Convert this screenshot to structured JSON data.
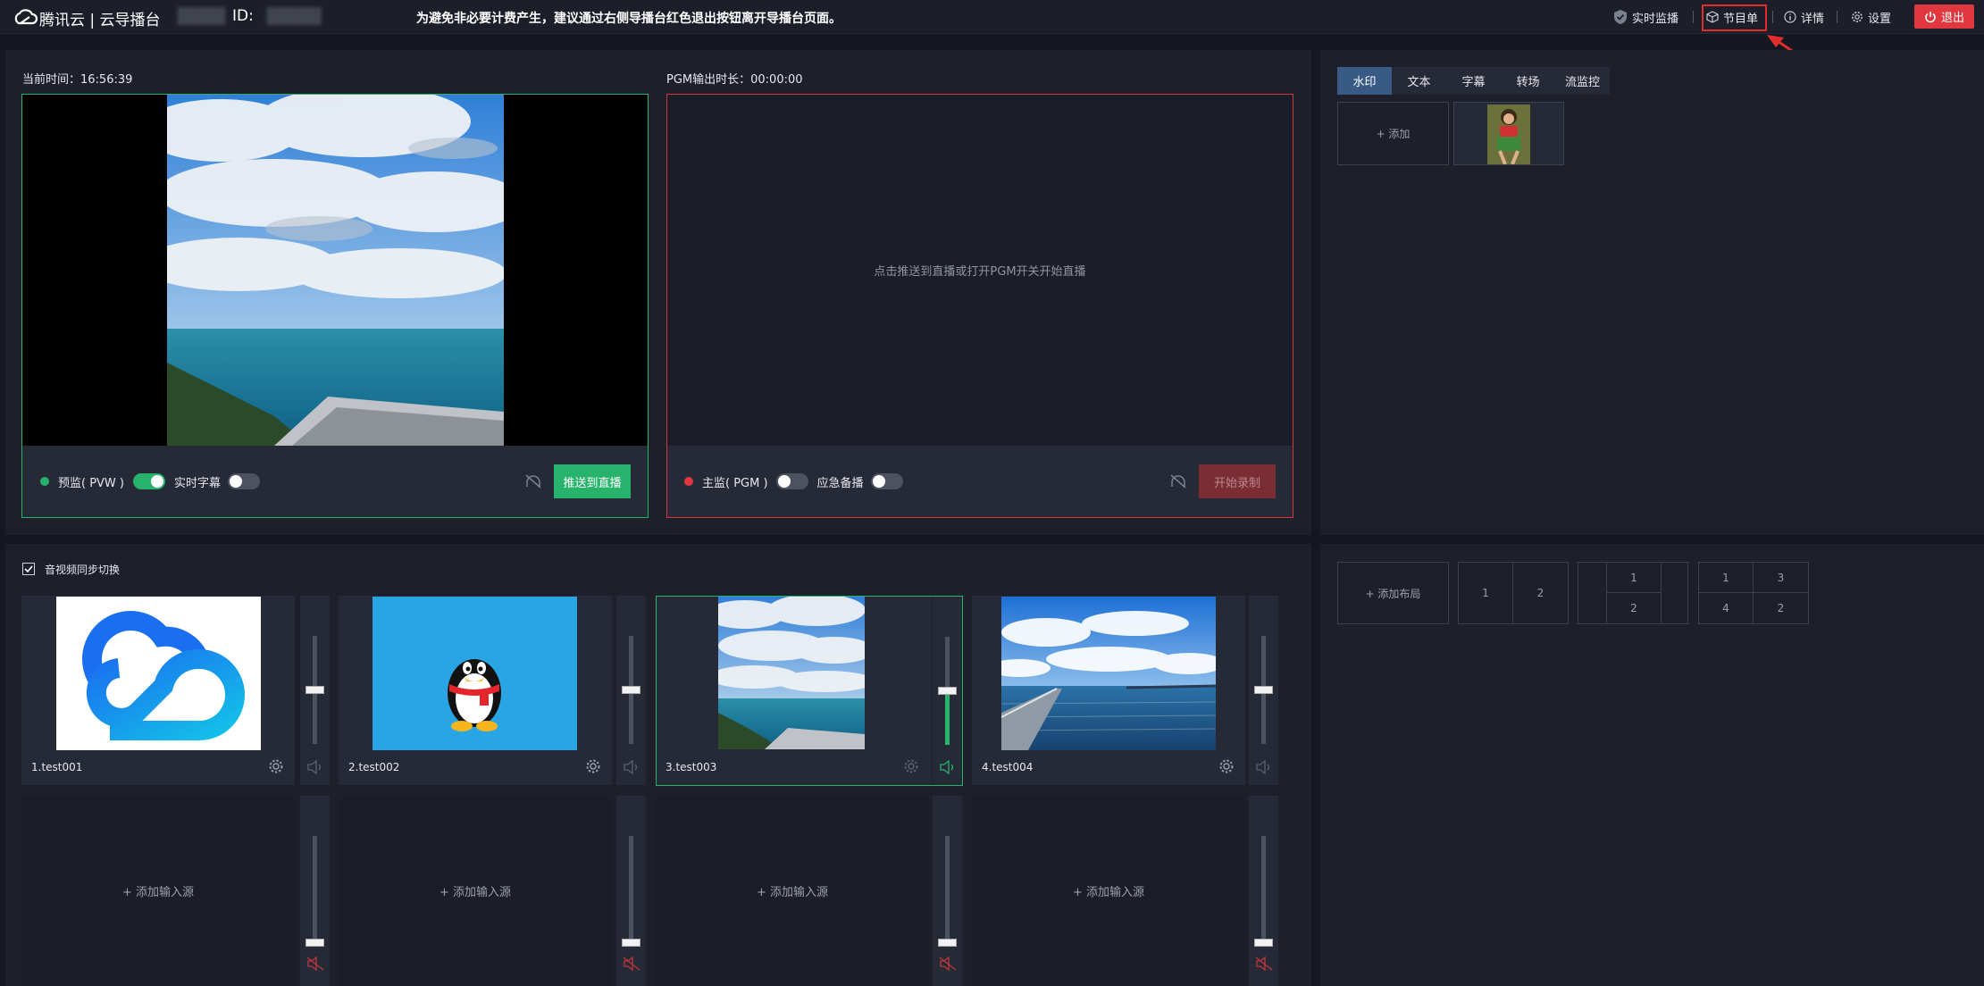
{
  "header": {
    "brand": "腾讯云 | 云导播台",
    "id_label": "ID:",
    "notice": "为避免非必要计费产生，建议通过右侧导播台红色退出按钮离开导播台页面。",
    "realtime_monitor": "实时监播",
    "program_list": "节目单",
    "details": "详情",
    "settings": "设置",
    "exit": "退出"
  },
  "preview": {
    "time_label": "当前时间：16:56:39",
    "pvw_label": "预监( PVW )",
    "pvw_toggle_on": true,
    "subtitle_label": "实时字幕",
    "subtitle_toggle_on": false,
    "push_button": "推送到直播"
  },
  "program": {
    "duration_label": "PGM输出时长：00:00:00",
    "placeholder": "点击推送到直播或打开PGM开关开始直播",
    "pgm_label": "主监( PGM )",
    "pgm_toggle_on": false,
    "backup_label": "应急备播",
    "backup_toggle_on": false,
    "record_button": "开始录制"
  },
  "right_tabs": [
    "水印",
    "文本",
    "字幕",
    "转场",
    "流监控"
  ],
  "watermark": {
    "add_label": "+ 添加"
  },
  "sources": {
    "sync_label": "音视频同步切换",
    "items": [
      {
        "name": "1.test001",
        "level": 0.5
      },
      {
        "name": "2.test002",
        "level": 0.5
      },
      {
        "name": "3.test003",
        "level": 0.5
      },
      {
        "name": "4.test004",
        "level": 0.5
      }
    ],
    "add_label": "+ 添加输入源"
  },
  "layouts": {
    "add_label": "+ 添加布局",
    "two": [
      "1",
      "2"
    ],
    "pip": [
      "1",
      "2"
    ],
    "four": [
      "1",
      "3",
      "4",
      "2"
    ]
  },
  "colors": {
    "accent": "#27b36b",
    "danger": "#e0383e",
    "tab_active": "#3a5a86"
  }
}
